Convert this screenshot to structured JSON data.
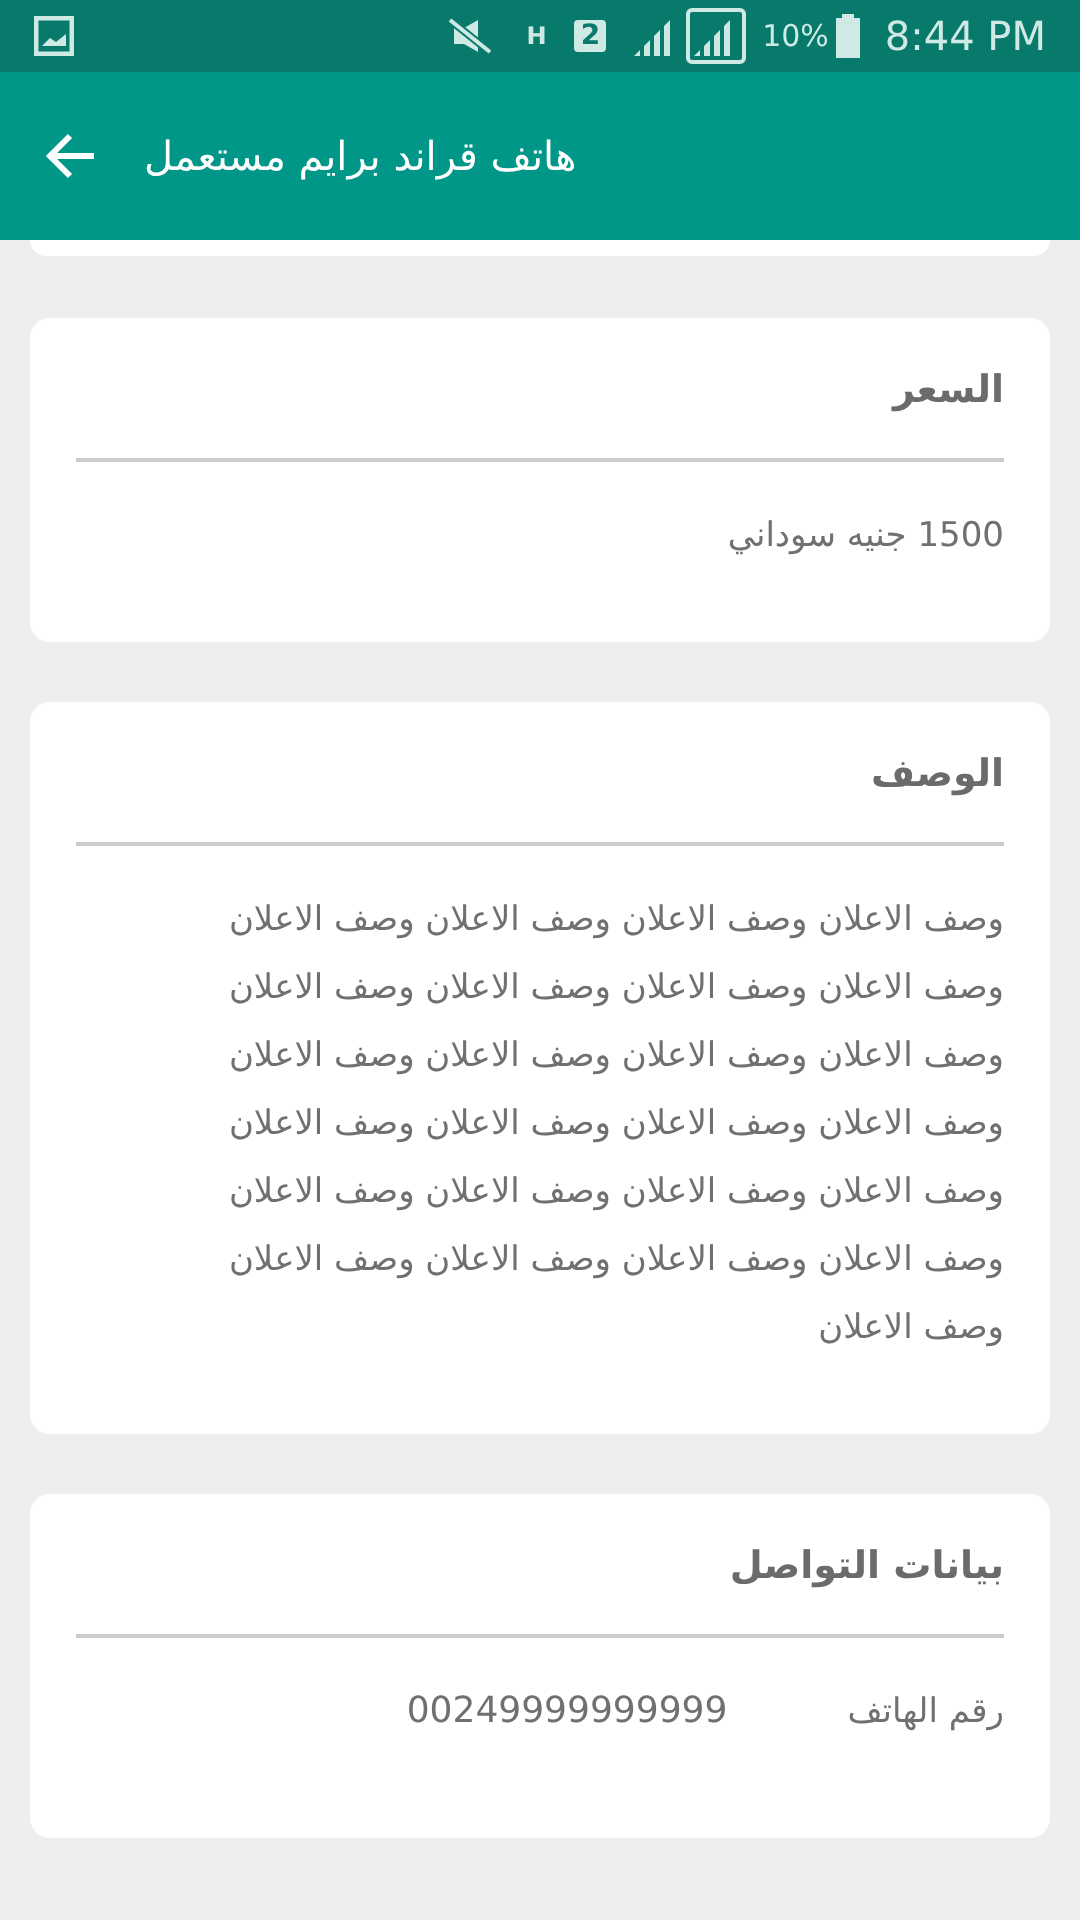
{
  "status_bar": {
    "battery": "10%",
    "time": "8:44 PM",
    "sim": "2",
    "network": "H"
  },
  "app_bar": {
    "title": "هاتف قراند برايم مستعمل"
  },
  "cards": [
    {
      "kind": "text",
      "title": "السعر",
      "body": "1500 جنيه سوداني"
    },
    {
      "kind": "text",
      "title": "الوصف",
      "body": "وصف الاعلان وصف الاعلان وصف الاعلان وصف الاعلان وصف الاعلان وصف الاعلان وصف الاعلان وصف الاعلان وصف الاعلان وصف الاعلان وصف الاعلان وصف الاعلان وصف الاعلان وصف الاعلان وصف الاعلان وصف الاعلان وصف الاعلان وصف الاعلان وصف الاعلان وصف الاعلان وصف الاعلان وصف الاعلان وصف الاعلان وصف الاعلان وصف الاعلان"
    },
    {
      "kind": "field",
      "title": "بيانات التواصل",
      "label": "رقم الهاتف",
      "value": "00249999999999"
    }
  ]
}
